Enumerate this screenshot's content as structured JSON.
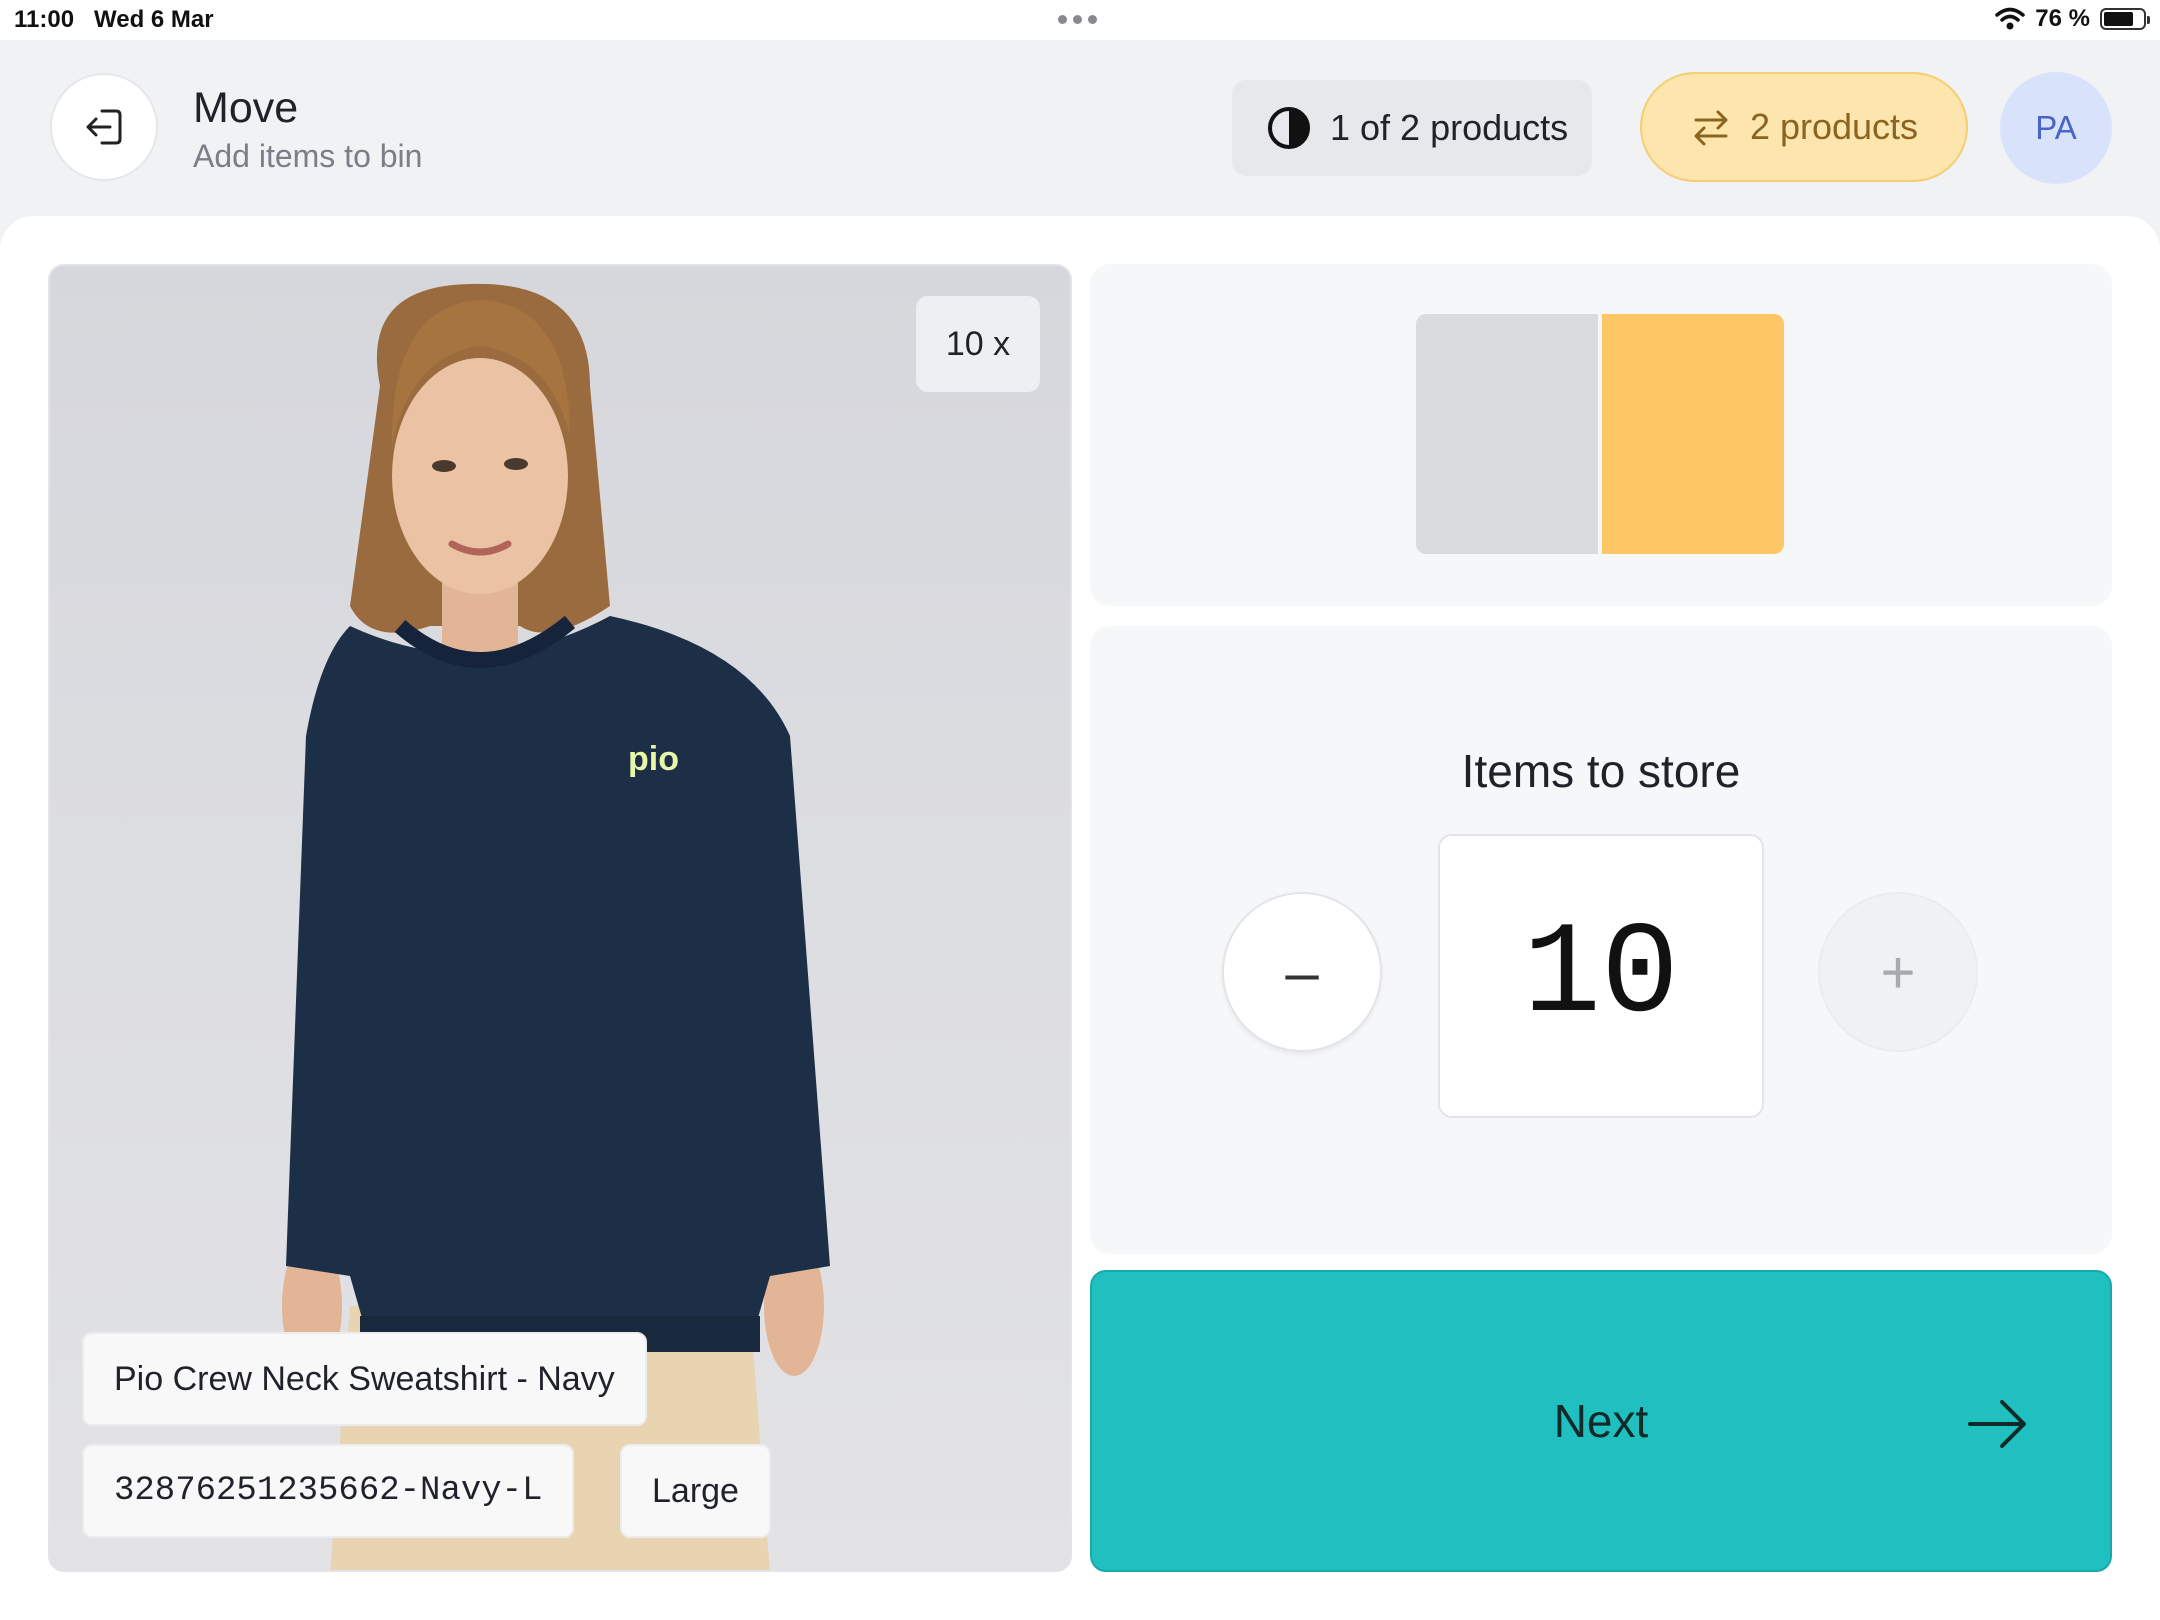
{
  "status_bar": {
    "time": "11:00",
    "date": "Wed 6 Mar",
    "battery_text": "76 %",
    "battery_level": 0.76
  },
  "header": {
    "title": "Move",
    "subtitle": "Add items to bin",
    "progress_label": "1 of 2 products",
    "products_button_label": "2 products",
    "avatar_initials": "PA"
  },
  "product": {
    "quantity_badge": "10 x",
    "name": "Pio Crew Neck Sweatshirt - Navy",
    "sku": "32876251235662-Navy-L",
    "size": "Large",
    "logo_text": "pio"
  },
  "bin": {
    "slot_colors": [
      "#dadbdf",
      "#fec665"
    ],
    "selected_slot": 2
  },
  "quantity": {
    "label": "Items to store",
    "value": "10",
    "minus_symbol": "–",
    "plus_symbol": "+"
  },
  "actions": {
    "next_label": "Next"
  },
  "colors": {
    "accent": "#20c0c0",
    "products_button": "#fde6ad",
    "avatar_bg": "#d9e2fb",
    "bin_selected": "#fec665",
    "sweatshirt": "#1d2f47"
  },
  "icons": {
    "back": "exit-arrow-icon",
    "progress": "half-circle-icon",
    "products": "swap-arrows-icon",
    "next": "arrow-right-icon",
    "wifi": "wifi-icon",
    "battery": "battery-icon"
  }
}
